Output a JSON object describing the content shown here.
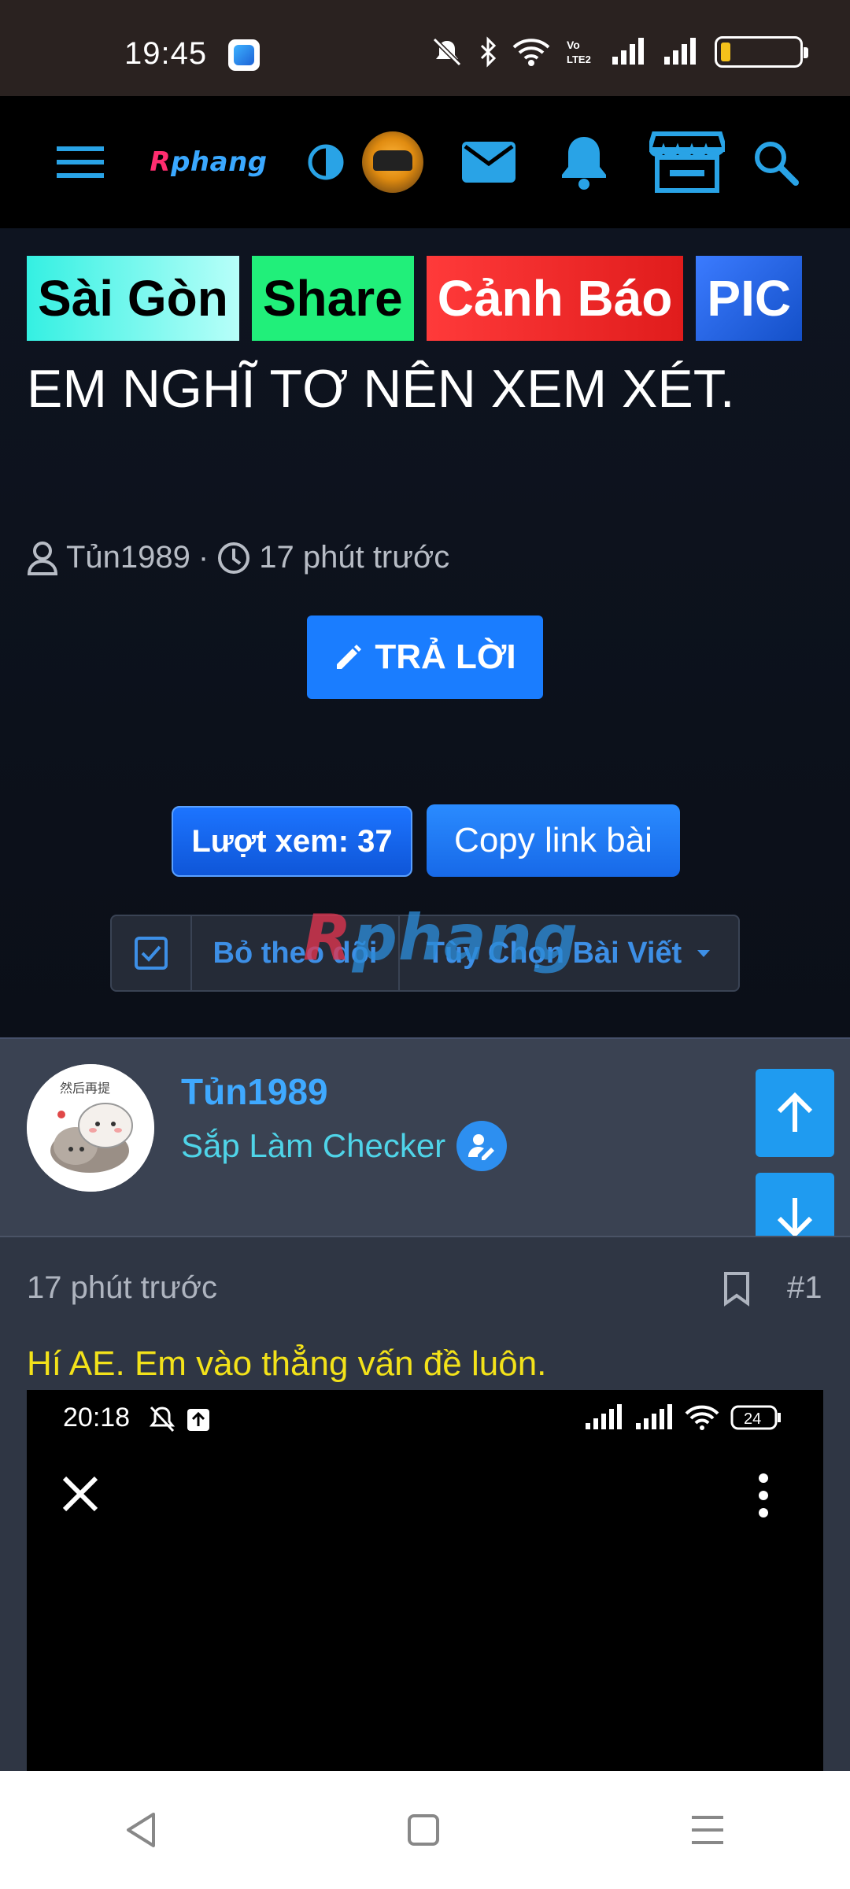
{
  "status_bar": {
    "time": "19:45"
  },
  "top_nav": {
    "logo_r": "R",
    "logo_rest": "phang"
  },
  "thread": {
    "tags": [
      "Sài Gòn",
      "Share",
      "Cảnh Báo",
      "PIC"
    ],
    "title": "EM NGHĨ TƠ NÊN XEM XÉT.",
    "author": "Tủn1989",
    "separator": "·",
    "time": "17 phút trước",
    "reply_label": "TRẢ LỜI",
    "views_label": "Lượt xem: 37",
    "copy_link_label": "Copy link bài",
    "unfollow_label": "Bỏ theo dõi",
    "options_label": "Tùy Chọn Bài Viết",
    "watermark_r": "R",
    "watermark_rest": "phang"
  },
  "author_card": {
    "name": "Tủn1989",
    "role": "Sắp Làm Checker"
  },
  "post": {
    "time": "17 phút trước",
    "number": "#1",
    "text": "Hí AE. Em vào thẳng vấn đề luôn.",
    "embedded_time": "20:18",
    "embedded_battery": "24"
  },
  "colors": {
    "accent": "#1a7dff",
    "link": "#3fa9ff",
    "post_text": "#f3e21a"
  }
}
